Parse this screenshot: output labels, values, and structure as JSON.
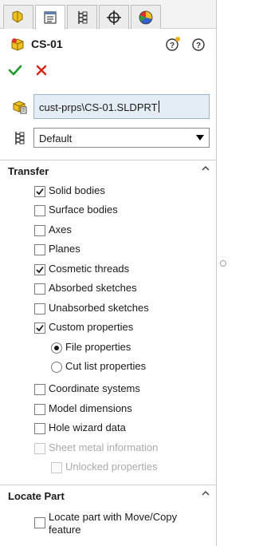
{
  "tabs": [
    {
      "icon": "property-manager-icon"
    },
    {
      "icon": "feature-manager-icon"
    },
    {
      "icon": "configuration-manager-icon"
    },
    {
      "icon": "dimxpert-manager-icon"
    },
    {
      "icon": "display-manager-icon"
    }
  ],
  "header": {
    "title": "CS-01",
    "icons": [
      "part-icon",
      "whats-new-icon",
      "help-icon"
    ]
  },
  "actions": {
    "ok": "ok-icon",
    "cancel": "cancel-icon"
  },
  "file": {
    "path": "cust-prps\\CS-01.SLDPRT"
  },
  "configuration": {
    "selected": "Default"
  },
  "transfer": {
    "title": "Transfer",
    "items": [
      {
        "label": "Solid bodies",
        "checked": true
      },
      {
        "label": "Surface bodies",
        "checked": false
      },
      {
        "label": "Axes",
        "checked": false
      },
      {
        "label": "Planes",
        "checked": false
      },
      {
        "label": "Cosmetic threads",
        "checked": true
      },
      {
        "label": "Absorbed sketches",
        "checked": false
      },
      {
        "label": "Unabsorbed sketches",
        "checked": false
      },
      {
        "label": "Custom properties",
        "checked": true
      }
    ],
    "radios": [
      {
        "label": "File properties",
        "selected": true
      },
      {
        "label": "Cut list properties",
        "selected": false
      }
    ],
    "items2": [
      {
        "label": "Coordinate systems",
        "checked": false
      },
      {
        "label": "Model dimensions",
        "checked": false
      },
      {
        "label": "Hole wizard data",
        "checked": false
      },
      {
        "label": "Sheet metal information",
        "checked": false,
        "disabled": true
      }
    ],
    "sub": {
      "label": "Unlocked properties",
      "checked": false,
      "disabled": true
    }
  },
  "locate": {
    "title": "Locate Part",
    "label_line1": "Locate part with Move/Copy",
    "label_line2": "feature",
    "checked": false
  },
  "colors": {
    "accent_check": "#1f9a2a",
    "cancel_red": "#d9221c",
    "field_bg": "#e4edf5"
  }
}
